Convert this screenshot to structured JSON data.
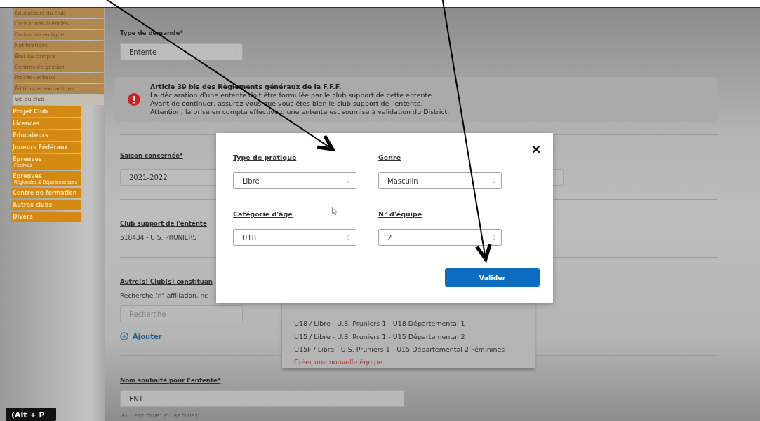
{
  "sidebar": {
    "submenu": [
      {
        "label": "Éducateurs du club",
        "selected": false
      },
      {
        "label": "Cotisations licenciés",
        "selected": false
      },
      {
        "label": "Cotisation en ligne",
        "selected": false
      },
      {
        "label": "Notifications",
        "selected": false
      },
      {
        "label": "État du compte",
        "selected": false
      },
      {
        "label": "Centres de gestion",
        "selected": false
      },
      {
        "label": "Procès-verbaux",
        "selected": false
      },
      {
        "label": "Éditions et extractions",
        "selected": false
      },
      {
        "label": "Vie du club",
        "selected": true
      }
    ],
    "items": [
      {
        "label": "Projet Club"
      },
      {
        "label": "Licences"
      },
      {
        "label": "Educateurs"
      },
      {
        "label": "Joueurs Fédéraux"
      },
      {
        "label": "Epreuves",
        "sublabel": "Festivals"
      },
      {
        "label": "Epreuves",
        "sublabel": "Régionales & Départementales"
      },
      {
        "label": "Centre de formation"
      },
      {
        "label": "Autres clubs"
      },
      {
        "label": "Divers"
      }
    ]
  },
  "form": {
    "type_demande": {
      "label": "Type de demande*",
      "value": "Entente"
    },
    "alert": {
      "title": "Article 39 bis des Règlements généraux de la F.F.F.",
      "lines": [
        "La déclaration d'une entente doit être formulée par le club support de cette entente.",
        "Avant de continuer, assurez-vous que vous êtes bien le club support de l'entente.",
        "Attention, la prise en compte effective d'une entente est soumise à validation du District."
      ]
    },
    "saison": {
      "label": "Saison concernée*",
      "value": "2021-2022"
    },
    "club_support": {
      "label": "Club support de l'entente",
      "value": "518434 - U.S. PRUNIERS"
    },
    "autres_clubs": {
      "label": "Autre(s) Club(s) constituan",
      "hint": "Recherche (n° affiliation, nc",
      "search_placeholder": "Recherche",
      "add_label": "Ajouter"
    },
    "nom": {
      "label": "Nom souhaité pour l'entente*",
      "value": "ENT.",
      "hint": "(Ex. : ENT. CLUB1 CLUB2 CLUB3)"
    }
  },
  "dropdown": {
    "items": [
      "U18 / Libre - U.S. Pruniers 1 - U18 Départemental 1",
      "U15 / Libre - U.S. Pruniers 1 - U15 Départemental 2",
      "U15F / Libre - U.S. Pruniers 1 - U15 Départemental 2 Féminines"
    ],
    "create_label": "Créer une nouvelle équipe"
  },
  "modal": {
    "fields": [
      {
        "label": "Type de pratique",
        "value": "Libre"
      },
      {
        "label": "Genre",
        "value": "Masculin"
      },
      {
        "label": "Catégorie d'âge",
        "value": "U18"
      },
      {
        "label": "N° d'équipe",
        "value": "2"
      }
    ],
    "submit": "Valider"
  },
  "tooltip": "(Alt + P"
}
